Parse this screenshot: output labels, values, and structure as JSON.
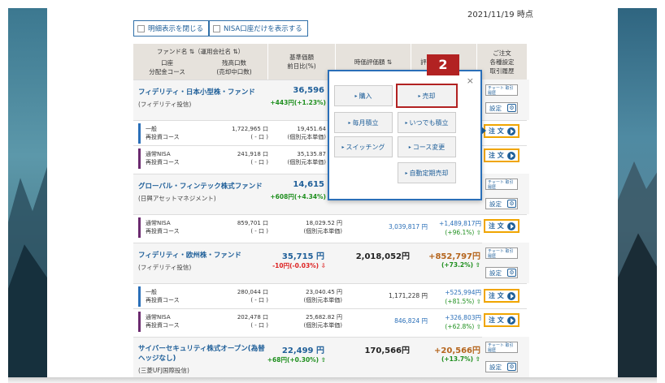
{
  "date": "2021/11/19 時点",
  "toggles": {
    "hide_details": "明細表示を閉じる",
    "nisa_only": "NISA口座だけを表示する"
  },
  "header": {
    "fund_name": "ファンド名 ⇅（運用会社名 ⇅）",
    "units_a": "口座",
    "units_b": "分配金コース",
    "balance_a": "残高口数",
    "balance_b": "(売却中口数)",
    "nav_a": "基準価額",
    "nav_b": "前日比(%)",
    "eval": "時価評価額 ⇅",
    "pl": "評",
    "ops_a": "ご注文",
    "ops_b": "各種設定",
    "ops_c": "取引履歴"
  },
  "step_badge": "2",
  "popup": {
    "close": "×",
    "buy": "購入",
    "sell": "売却",
    "monthly": "毎月積立",
    "anytime": "いつでも積立",
    "switch": "スイッチング",
    "course": "コース変更",
    "auto_sell": "自動定期売却"
  },
  "buttons": {
    "chart": "チャート 取引履歴",
    "settings": "設定",
    "order": "注 文"
  },
  "funds": [
    {
      "name": "フィデリティ・日本小型株・ファンド",
      "company": "(フィデリティ投信)",
      "nav": "36,596",
      "change": "+443円(+1.23%)",
      "subs": [
        {
          "type": "一般",
          "course": "再投資コース",
          "units": "1,722,965 口",
          "units2": "( - 口 )",
          "price": "19,451.64",
          "price2": "(個別元本単価)",
          "color": "#2a6fb8"
        },
        {
          "type": "通常NISA",
          "course": "再投資コース",
          "units": "241,918 口",
          "units2": "( - 口 )",
          "price": "35,135.87",
          "price2": "(個別元本単価)",
          "color": "#6b2a6f"
        }
      ]
    },
    {
      "name": "グローバル・フィンテック株式ファンド",
      "company": "(日興アセットマネジメント)",
      "nav": "14,615",
      "change": "+608円(+4.34%)",
      "subs": [
        {
          "type": "通常NISA",
          "course": "再投資コース",
          "units": "859,701 口",
          "units2": "( - 口 )",
          "price": "18,029.52 円",
          "price2": "(個別元本単価)",
          "eval": "3,039,817 円",
          "pl": "+1,489,817円",
          "pl_pct": "(+96.1%) ⇧",
          "color": "#6b2a6f"
        }
      ]
    },
    {
      "name": "フィデリティ・欧州株・ファンド",
      "company": "(フィデリティ投信)",
      "nav": "35,715 円",
      "change": "-10円(-0.03%) ⇩",
      "eval": "2,018,052円",
      "pl": "+852,797円",
      "pl_pct": "(+73.2%) ⇧",
      "subs": [
        {
          "type": "一般",
          "course": "再投資コース",
          "units": "280,044 口",
          "units2": "( - 口 )",
          "price": "23,040.45 円",
          "price2": "(個別元本単価)",
          "eval": "1,171,228 円",
          "pl": "+525,994円",
          "pl_pct": "(+81.5%) ⇧",
          "color": "#2a6fb8"
        },
        {
          "type": "通常NISA",
          "course": "再投資コース",
          "units": "202,478 口",
          "units2": "( - 口 )",
          "price": "25,682.82 円",
          "price2": "(個別元本単価)",
          "eval": "846,824 円",
          "pl": "+326,803円",
          "pl_pct": "(+62.8%) ⇧",
          "color": "#6b2a6f"
        }
      ]
    },
    {
      "name_a": "サイバーセキュリティ株式オープン(為替",
      "name_b": "ヘッジなし)",
      "company": "(三菱UFJ国際投信)",
      "nav": "22,499 円",
      "change": "+68円(+0.30%) ⇧",
      "eval": "170,566円",
      "pl": "+20,566円",
      "pl_pct": "(+13.7%) ⇧"
    }
  ]
}
